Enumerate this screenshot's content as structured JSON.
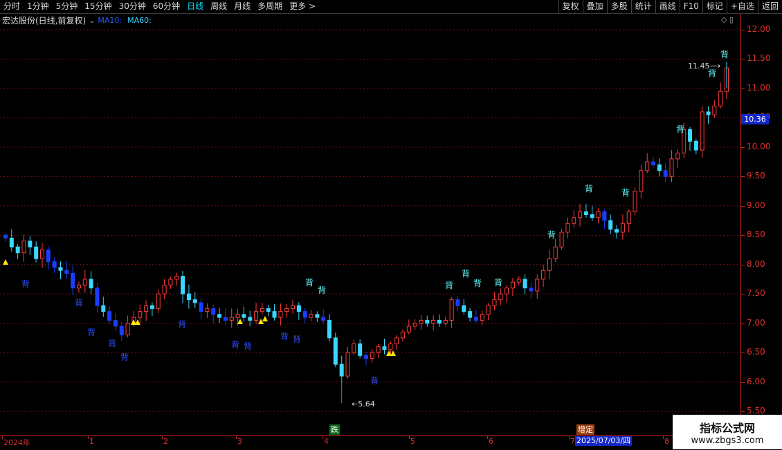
{
  "toolbar": {
    "periods": [
      "分时",
      "1分钟",
      "5分钟",
      "15分钟",
      "30分钟",
      "60分钟",
      "日线",
      "周线",
      "月线",
      "多周期",
      "更多 >"
    ],
    "active_period": "日线",
    "right_buttons": [
      "复权",
      "叠加",
      "多股",
      "统计",
      "画线",
      "F10",
      "标记",
      "+自选",
      "返回"
    ]
  },
  "info": {
    "stock_name": "宏达股份(日线,前复权)",
    "dropdown_icon": "⌄",
    "ma10": "MA10:",
    "ma60": "MA60:"
  },
  "axis": {
    "ticks": [
      "12.00",
      "11.50",
      "11.00",
      "10.50",
      "10.00",
      "9.50",
      "9.00",
      "8.50",
      "8.00",
      "7.50",
      "7.00",
      "6.50",
      "6.00",
      "5.50"
    ],
    "current_price": "10.36"
  },
  "labels": {
    "low": "5.64",
    "high": "11.45",
    "die": "跌",
    "zeng": "增定",
    "date": "2025/07/03/四",
    "bei": "背"
  },
  "months": [
    "2024年",
    "1",
    "2",
    "3",
    "4",
    "5",
    "6",
    "7",
    "8"
  ],
  "logo": {
    "line1": "指标公式网",
    "line2": "www.zbgs3.com"
  },
  "colors": {
    "up": "#ff3b3b",
    "down": "#3ad7ff",
    "blue_down": "#1b3cff",
    "bei_cyan": "#66ffff",
    "bei_blue": "#3050ff",
    "triangle": "#ffe600"
  },
  "chart_data": {
    "type": "candlestick",
    "ylim": [
      5.5,
      12.0
    ],
    "low_point": 5.64,
    "high_point": 11.45,
    "close_path": [
      8.45,
      8.3,
      8.2,
      8.4,
      8.3,
      8.1,
      8.25,
      8.05,
      7.95,
      7.9,
      7.85,
      7.6,
      7.65,
      7.75,
      7.6,
      7.3,
      7.2,
      7.05,
      6.95,
      6.8,
      7.0,
      7.1,
      7.2,
      7.3,
      7.25,
      7.5,
      7.65,
      7.75,
      7.8,
      7.5,
      7.4,
      7.35,
      7.2,
      7.25,
      7.15,
      7.1,
      7.05,
      7.1,
      7.15,
      7.1,
      7.05,
      7.2,
      7.25,
      7.2,
      7.1,
      7.2,
      7.25,
      7.3,
      7.2,
      7.1,
      7.15,
      7.1,
      7.05,
      6.75,
      6.3,
      6.1,
      6.5,
      6.65,
      6.45,
      6.4,
      6.5,
      6.6,
      6.55,
      6.65,
      6.75,
      6.85,
      6.95,
      7.0,
      7.05,
      7.0,
      7.05,
      7.0,
      7.05,
      7.4,
      7.3,
      7.2,
      7.1,
      7.05,
      7.15,
      7.3,
      7.4,
      7.5,
      7.6,
      7.7,
      7.75,
      7.6,
      7.55,
      7.75,
      7.9,
      8.1,
      8.3,
      8.55,
      8.7,
      8.8,
      8.9,
      8.85,
      8.8,
      8.9,
      8.75,
      8.6,
      8.55,
      8.7,
      8.9,
      9.25,
      9.6,
      9.75,
      9.7,
      9.6,
      9.5,
      9.8,
      9.9,
      10.3,
      10.1,
      9.95,
      10.6,
      10.55,
      10.7,
      10.95,
      11.35
    ]
  }
}
